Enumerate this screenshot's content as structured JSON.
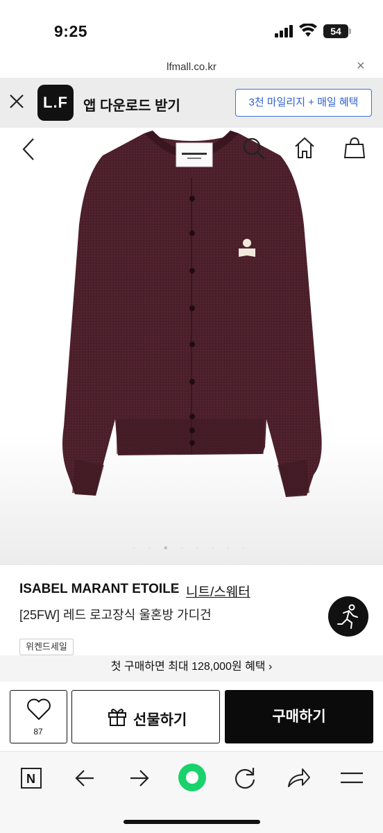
{
  "status_bar": {
    "time": "9:25",
    "battery": "54"
  },
  "url_bar": {
    "url": "lfmall.co.kr",
    "close_label": "×"
  },
  "app_banner": {
    "logo_text": "L.F",
    "title": "앱 다운로드 받기",
    "cta_label": "3천 마일리지 + 매일 혜택",
    "accent_color": "#3b6fd9"
  },
  "hero": {
    "nav_icons": [
      "back-icon",
      "search-icon",
      "home-icon",
      "shopping-bag-icon"
    ],
    "garment_color": "#4a1f2a",
    "pager": "· · ● · · · · ·"
  },
  "product": {
    "brand": "ISABEL MARANT ETOILE",
    "breadcrumb_sep": "›",
    "category": "니트/스웨터",
    "name": "[25FW] 레드 로고장식 울혼방 가디건",
    "tag": "위켄드세일"
  },
  "promo": {
    "text": "첫 구매하면 최대 128,000원 혜택 ›"
  },
  "actions": {
    "like_count": "87",
    "gift_label": "선물하기",
    "buy_label": "구매하기"
  },
  "browser_toolbar": {
    "icons": [
      "naver-n-icon",
      "back-arrow-icon",
      "forward-arrow-icon",
      "green-dot-icon",
      "refresh-icon",
      "share-icon",
      "menu-icon"
    ],
    "n_label": "N",
    "green": "#19d26b"
  }
}
